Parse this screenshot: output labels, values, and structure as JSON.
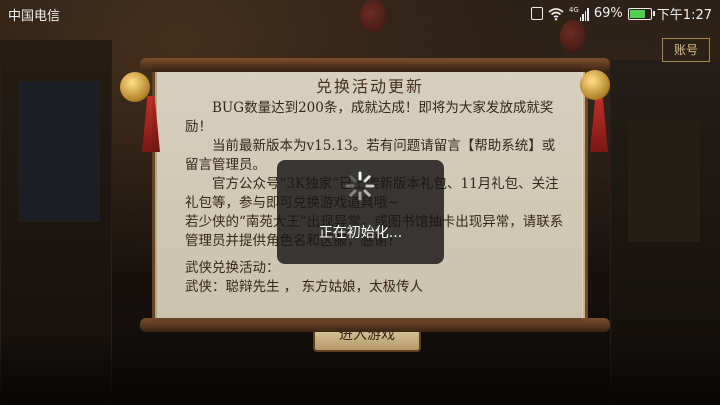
{
  "status_bar": {
    "carrier": "中国电信",
    "network_label": "4G",
    "battery_percent": "69%",
    "time": "下午1:27"
  },
  "game": {
    "top_button_label": "账号",
    "enter_button_label": "进入游戏"
  },
  "notice": {
    "title": "兑换活动更新",
    "paragraphs": [
      "BUG数量达到200条，成就达成！即将为大家发放成就奖励！",
      "当前最新版本为v15.13。若有问题请留言【帮助系统】或留言管理员。",
      "官方公众号“3K独家”已上架新版本礼包、11月礼包、关注礼包等，参与即可兑换游戏道具哦~",
      "若少侠的“南苑大王”出现异常，或图书馆抽卡出现异常，请联系管理员并提供角色名和区服，感谢！",
      "武侠兑换活动：",
      "武侠：聪辩先生 ， 东方姑娘，太极传人"
    ]
  },
  "loading": {
    "text": "正在初始化..."
  },
  "colors": {
    "panel_bg": "#e6dcc6",
    "panel_border": "#6b4b2d",
    "toast_bg": "#161616",
    "battery_fill": "#4fd14f"
  }
}
